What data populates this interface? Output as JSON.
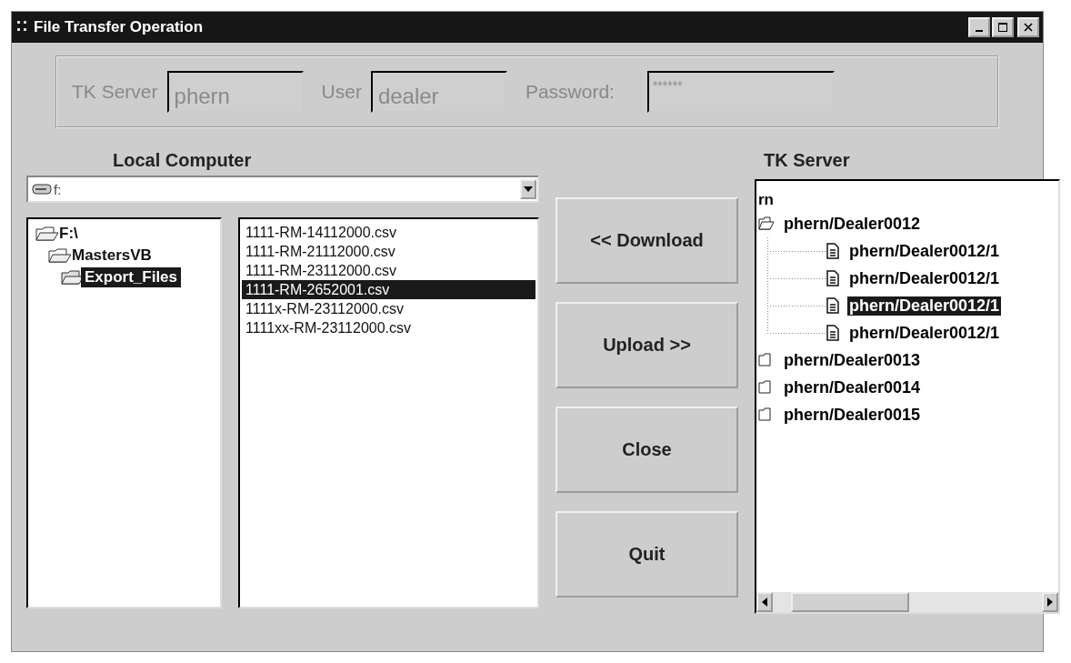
{
  "window": {
    "title": "File Transfer  Operation"
  },
  "login": {
    "disabled": true,
    "fields": [
      {
        "label": "TK Server",
        "value": "phern",
        "kind": "text"
      },
      {
        "label": "User",
        "value": "dealer",
        "kind": "text"
      },
      {
        "label": "Password:",
        "value": "******",
        "kind": "password"
      }
    ]
  },
  "local": {
    "heading": "Local Computer",
    "drive": "f:",
    "folders": [
      {
        "label": "F:\\",
        "expanded": true,
        "selected": false,
        "children": [
          {
            "label": "MastersVB",
            "expanded": true,
            "selected": false,
            "children": [
              {
                "label": "Export_Files",
                "expanded": true,
                "selected": true
              }
            ]
          }
        ]
      }
    ],
    "files": [
      {
        "name": "1111-RM-14112000.csv",
        "selected": false
      },
      {
        "name": "1111-RM-21112000.csv",
        "selected": false
      },
      {
        "name": "1111-RM-23112000.csv",
        "selected": false
      },
      {
        "name": "1111-RM-2652001.csv",
        "selected": true
      },
      {
        "name": "1111x-RM-23112000.csv",
        "selected": false
      },
      {
        "name": "1111xx-RM-23112000.csv",
        "selected": false
      }
    ]
  },
  "buttons": [
    "<< Download",
    "Upload >>",
    "Close",
    "Quit"
  ],
  "server": {
    "heading": "TK Server",
    "partial_top": "rn",
    "tree": [
      {
        "label": "phern/Dealer0012",
        "kind": "folder",
        "expanded": true,
        "selected": false,
        "children": [
          {
            "label": "phern/Dealer0012/1",
            "kind": "file",
            "selected": false
          },
          {
            "label": "phern/Dealer0012/1",
            "kind": "file",
            "selected": false
          },
          {
            "label": "phern/Dealer0012/1",
            "kind": "file",
            "selected": true
          },
          {
            "label": "phern/Dealer0012/1",
            "kind": "file",
            "selected": false
          }
        ]
      },
      {
        "label": "phern/Dealer0013",
        "kind": "folder",
        "expanded": false,
        "selected": false
      },
      {
        "label": "phern/Dealer0014",
        "kind": "folder",
        "expanded": false,
        "selected": false
      },
      {
        "label": "phern/Dealer0015",
        "kind": "folder",
        "expanded": false,
        "selected": false
      }
    ]
  }
}
